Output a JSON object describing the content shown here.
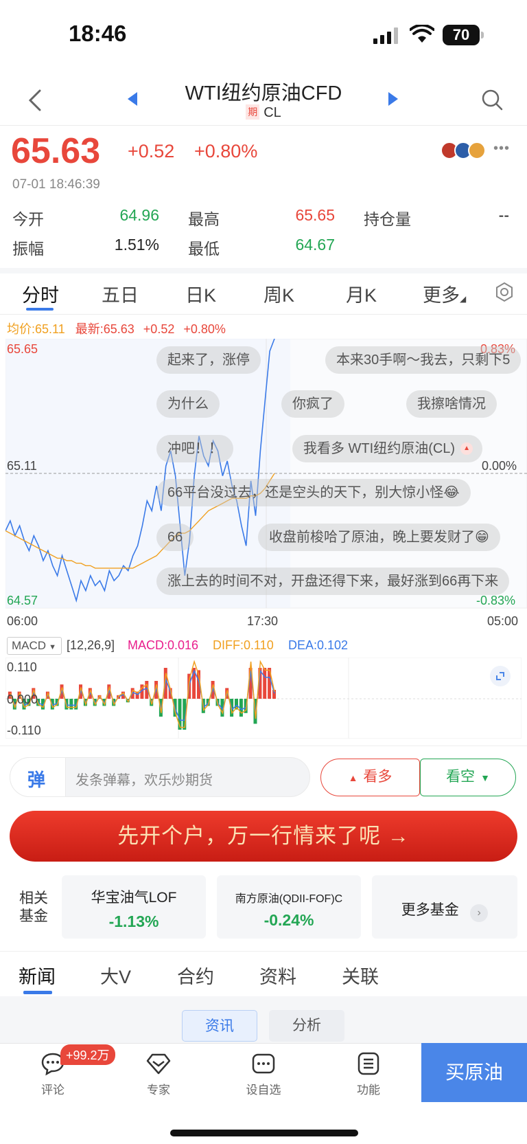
{
  "status_bar": {
    "time": "18:46",
    "battery": "70"
  },
  "nav": {
    "title": "WTI纽约原油CFD",
    "tag": "期",
    "symbol": "CL"
  },
  "quote": {
    "price": "65.63",
    "change": "+0.52",
    "change_pct": "+0.80%",
    "time": "07-01 18:46:39",
    "stats": [
      {
        "label": "今开",
        "value": "64.96",
        "color": "#23a654"
      },
      {
        "label": "最高",
        "value": "65.65",
        "color": "#e8473b"
      },
      {
        "label": "持仓量",
        "value": "--",
        "color": "#222"
      },
      {
        "label": "振幅",
        "value": "1.51%",
        "color": "#222"
      },
      {
        "label": "最低",
        "value": "64.67",
        "color": "#23a654"
      }
    ]
  },
  "chart_tabs": [
    "分时",
    "五日",
    "日K",
    "周K",
    "月K",
    "更多"
  ],
  "chart_info": {
    "avg": "均价:65.11",
    "latest": "最新:65.63",
    "change": "+0.52",
    "change_pct": "+0.80%"
  },
  "chart_axes": {
    "y_top": "65.65",
    "y_mid": "65.11",
    "y_bot": "64.57",
    "pct_top": "0.83%",
    "pct_mid": "0.00%",
    "pct_bot": "-0.83%",
    "times": [
      "06:00",
      "17:30",
      "05:00"
    ]
  },
  "chart_data": {
    "type": "line",
    "x_labels": [
      "06:00",
      "17:30",
      "05:00"
    ],
    "ylim": [
      64.57,
      65.65
    ],
    "reference": 65.11,
    "series": [
      {
        "color": "#3a7ae8",
        "values": [
          64.88,
          64.92,
          64.86,
          64.9,
          64.84,
          64.8,
          64.86,
          64.82,
          64.76,
          64.8,
          64.74,
          64.7,
          64.78,
          64.72,
          64.66,
          64.6,
          64.68,
          64.64,
          64.7,
          64.66,
          64.68,
          64.64,
          64.72,
          64.68,
          64.7,
          64.74,
          64.72,
          64.78,
          64.82,
          64.9,
          65.0,
          64.96,
          65.06,
          64.96,
          65.14,
          65.2,
          65.1,
          64.9,
          64.7,
          64.84,
          65.1,
          65.26,
          65.18,
          65.14,
          65.24,
          65.2,
          65.1,
          65.16,
          65.06,
          65.0,
          64.9,
          64.82,
          65.08,
          64.94,
          65.2,
          65.4,
          65.6,
          65.65
        ]
      },
      {
        "color": "#f0a020",
        "values": [
          64.88,
          64.87,
          64.86,
          64.85,
          64.84,
          64.83,
          64.82,
          64.81,
          64.8,
          64.79,
          64.78,
          64.77,
          64.77,
          64.76,
          64.76,
          64.75,
          64.75,
          64.74,
          64.74,
          64.73,
          64.73,
          64.73,
          64.73,
          64.73,
          64.73,
          64.73,
          64.73,
          64.73,
          64.74,
          64.75,
          64.76,
          64.77,
          64.78,
          64.8,
          64.82,
          64.84,
          64.86,
          64.87,
          64.87,
          64.88,
          64.9,
          64.92,
          64.94,
          64.96,
          64.97,
          64.98,
          64.99,
          65.0,
          65.01,
          65.01,
          65.01,
          65.01,
          65.02,
          65.02,
          65.03,
          65.05,
          65.08,
          65.11
        ]
      }
    ]
  },
  "danmu": [
    "起来了，涨停",
    "本来30手啊～我去，只剩下5",
    "为什么",
    "你疯了",
    "我擦啥情况",
    "冲吧！！",
    "我看多 WTI纽约原油(CL)",
    "66平台没过去，还是空头的天下，别大惊小怪😂",
    "66",
    "收盘前梭哈了原油，晚上要发财了😁",
    "涨上去的时间不对，开盘还得下来，最好涨到66再下来"
  ],
  "macd": {
    "selector": "MACD",
    "params": "[12,26,9]",
    "macd": "MACD:0.016",
    "diff": "DIFF:0.110",
    "dea": "DEA:0.102",
    "y_top": "0.110",
    "y_mid": "0.000",
    "y_bot": "-0.110",
    "colors": {
      "macd": "#e91e8c",
      "diff": "#f0a020",
      "dea": "#3a7ae8"
    }
  },
  "comment": {
    "icon": "弹",
    "placeholder": "发条弹幕，欢乐炒期货",
    "bull": "看多",
    "bear": "看空"
  },
  "banner": {
    "text": "先开个户，万一行情来了呢 →"
  },
  "funds": {
    "label_1": "相关",
    "label_2": "基金",
    "items": [
      {
        "name": "华宝油气LOF",
        "change": "-1.13%"
      },
      {
        "name": "南方原油(QDII-FOF)C",
        "change": "-0.24%"
      }
    ],
    "more": "更多基金"
  },
  "news_tabs": [
    "新闻",
    "大V",
    "合约",
    "资料",
    "关联"
  ],
  "sub_tabs": [
    "资讯",
    "分析"
  ],
  "bottom_bar": {
    "badge": "+99.2万",
    "items": [
      "评论",
      "专家",
      "设自选",
      "功能"
    ],
    "buy": "买原油"
  }
}
